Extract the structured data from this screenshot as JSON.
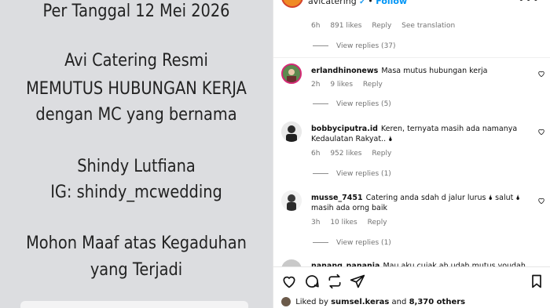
{
  "post_image": {
    "lines": [
      "Per Tanggal 12 Mei 2026",
      "Avi Catering Resmi",
      "MEMUTUS HUBUNGAN KERJA",
      "dengan MC yang bernama",
      "Shindy Lutfiana",
      "IG: shindy_mcwedding",
      "Mohon Maaf atas Kegaduhan",
      "yang Terjadi"
    ]
  },
  "header": {
    "username": "avicatering",
    "verified": "✔",
    "separator": "•",
    "follow": "Follow",
    "more": "•••"
  },
  "first_meta": {
    "time": "6h",
    "likes": "891 likes",
    "reply": "Reply",
    "translation": "See translation"
  },
  "first_replies": "View replies (37)",
  "comments": [
    {
      "username": "erlandhinonews",
      "text": "Masa mutus hubungan kerja",
      "time": "2h",
      "likes": "9 likes",
      "reply": "Reply",
      "replies": "View replies (5)",
      "avatar_color": "#3b6e3a"
    },
    {
      "username": "bobbyciputra.id",
      "text": "Keren, ternyata masih ada namanya Kedaulatan Rakyat.. 🌢",
      "time": "6h",
      "likes": "952 likes",
      "reply": "Reply",
      "replies": "View replies (1)",
      "avatar_color": "#e9e9e9"
    },
    {
      "username": "musse_7451",
      "text": "Catering anda sdah d jalur lurus 🌢 salut 🌢 masih ada orng baik",
      "time": "3h",
      "likes": "10 likes",
      "reply": "Reply",
      "replies": "View replies (1)",
      "avatar_color": "#f0f0f0"
    },
    {
      "username": "nanang_nanania",
      "text": "Mau aku cuiak ah udah mutus voudah sejadi",
      "avatar_color": "#c9c9c9"
    }
  ],
  "actions": {
    "liked_by_prefix": "Liked by",
    "liked_by_user": "sumsel.keras",
    "and": "and",
    "others": "8,370 others"
  }
}
